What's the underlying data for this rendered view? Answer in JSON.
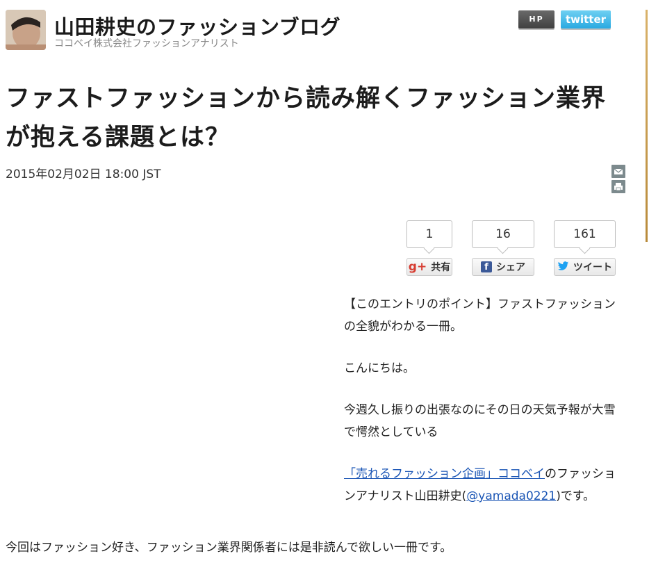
{
  "blog": {
    "title": "山田耕史のファッションブログ",
    "subtitle": "ココベイ株式会社ファッションアナリスト",
    "hp_label": "HP",
    "twitter_label": "twitter"
  },
  "article": {
    "title": "ファストファッションから読み解くファッション業界が抱える課題とは？",
    "date": "2015年02月02日 18:00 JST"
  },
  "share": {
    "gplus": {
      "count": "1",
      "label": "共有",
      "icon": "g+"
    },
    "facebook": {
      "count": "16",
      "label": "シェア",
      "icon": "f"
    },
    "twitter": {
      "count": "161",
      "label": "ツイート",
      "icon": "bird"
    }
  },
  "sidebar_icons": [
    "mail-icon",
    "print-icon"
  ],
  "content": {
    "point": "【このエントリのポイント】ファストファッションの全貌がわかる一冊。",
    "greeting": "こんにちは。",
    "weather": "今週久し振りの出張なのにその日の天気予報が大雪で愕然としている",
    "intro_link": "「売れるファッション企画」ココベイ",
    "intro_mid": "のファッションアナリスト山田耕史(",
    "intro_handle": "@yamada0221",
    "intro_end": ")です。",
    "recommend": "今回はファッション好き、ファッション業界関係者には是非読んで欲しい一冊です。"
  },
  "colors": {
    "accent_gold": "#c89a4a",
    "link": "#1a55b5",
    "twitter_blue": "#29a9e1",
    "facebook_blue": "#3b5998",
    "gplus_red": "#d73d32"
  }
}
